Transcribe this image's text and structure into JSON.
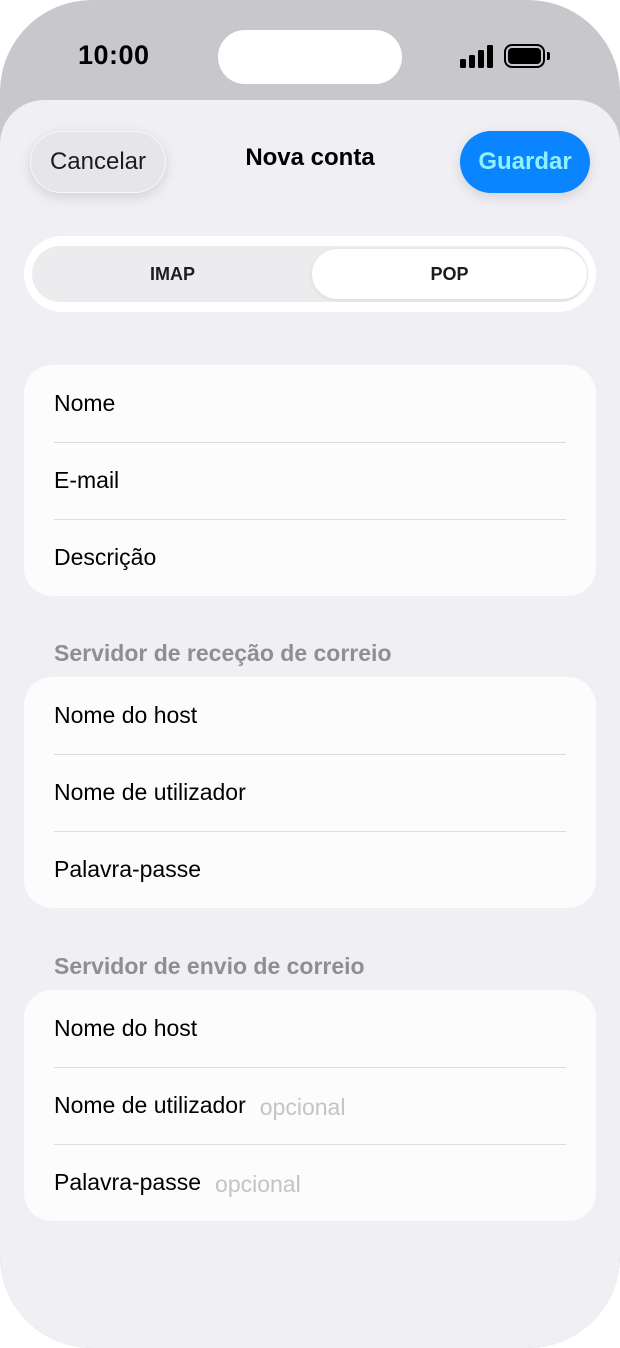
{
  "status_bar": {
    "time": "10:00"
  },
  "nav": {
    "cancel_label": "Cancelar",
    "title": "Nova conta",
    "save_label": "Guardar"
  },
  "segmented": {
    "options": [
      "IMAP",
      "POP"
    ],
    "selected": "POP"
  },
  "account_fields": [
    {
      "label": "Nome",
      "placeholder": ""
    },
    {
      "label": "E-mail",
      "placeholder": ""
    },
    {
      "label": "Descrição",
      "placeholder": ""
    }
  ],
  "incoming": {
    "header": "Servidor de receção de correio",
    "fields": [
      {
        "label": "Nome do host",
        "placeholder": ""
      },
      {
        "label": "Nome de utilizador",
        "placeholder": ""
      },
      {
        "label": "Palavra-passe",
        "placeholder": ""
      }
    ]
  },
  "outgoing": {
    "header": "Servidor de envio de correio",
    "fields": [
      {
        "label": "Nome do host",
        "placeholder": ""
      },
      {
        "label": "Nome de utilizador",
        "placeholder": "opcional"
      },
      {
        "label": "Palavra-passe",
        "placeholder": "opcional"
      }
    ]
  },
  "colors": {
    "accent": "#0a84ff",
    "save_text": "#8ff0ff",
    "background": "#efeff4"
  }
}
